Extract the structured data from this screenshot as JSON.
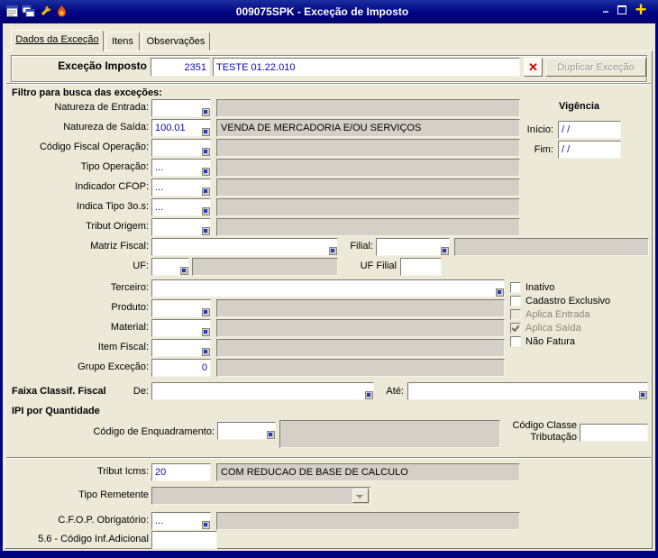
{
  "titlebar": {
    "title": "009075SPK - Exceção de Imposto",
    "minimize_glyph": "−",
    "close_glyph": "+"
  },
  "tabs": {
    "dados": "Dados da Exceção",
    "itens": "Itens",
    "observacoes": "Observações"
  },
  "header": {
    "label": "Exceção Imposto",
    "code": "2351",
    "description": "TESTE 01.22.010",
    "delete_glyph": "✕",
    "duplicate_label": "Duplicar Exceção"
  },
  "filter": {
    "title": "Filtro para busca das exceções:",
    "rows": [
      {
        "label": "Natureza de Entrada:",
        "value": "",
        "detail": ""
      },
      {
        "label": "Natureza de Saída:",
        "value": "100.01",
        "detail": "VENDA DE MERCADORIA E/OU SERVIÇOS"
      },
      {
        "label": "Código Fiscal Operação:",
        "value": "",
        "detail": ""
      },
      {
        "label": "Tipo Operação:",
        "value": "...",
        "detail": ""
      },
      {
        "label": "Indicador CFOP:",
        "value": "...",
        "detail": ""
      },
      {
        "label": "Indica Tipo 3o.s:",
        "value": "...",
        "detail": ""
      },
      {
        "label": "Tribut Origem:",
        "value": "",
        "detail": ""
      }
    ],
    "vigencia": {
      "title": "Vigência",
      "inicio_label": "Início:",
      "inicio_value": "/ /",
      "fim_label": "Fim:",
      "fim_value": "/ /"
    },
    "matriz": {
      "label": "Matriz Fiscal:",
      "value": "",
      "filial_label": "Filial:",
      "filial_value": "",
      "filial_detail": ""
    },
    "uf": {
      "label": "UF:",
      "value": "",
      "detail": "",
      "filial_label": "UF Filial",
      "filial_value": ""
    },
    "terceiro": {
      "label": "Terceiro:",
      "value": ""
    },
    "produto": {
      "label": "Produto:",
      "value": "",
      "detail": ""
    },
    "material": {
      "label": "Material:",
      "value": "",
      "detail": ""
    },
    "item_fiscal": {
      "label": "Item Fiscal:",
      "value": "",
      "detail": ""
    },
    "grupo": {
      "label": "Grupo Exceção:",
      "value": "0",
      "detail": ""
    },
    "checkboxes": [
      {
        "label": "Inativo",
        "checked": false,
        "enabled": true
      },
      {
        "label": "Cadastro Exclusivo",
        "checked": false,
        "enabled": true
      },
      {
        "label": "Aplica Entrada",
        "checked": false,
        "enabled": false
      },
      {
        "label": "Aplica Saída",
        "checked": true,
        "enabled": false
      },
      {
        "label": "Não Fatura",
        "checked": false,
        "enabled": true
      }
    ]
  },
  "faixa": {
    "title": "Faixa Classif. Fiscal",
    "de_label": "De:",
    "de_value": "",
    "ate_label": "Até:",
    "ate_value": ""
  },
  "ipi": {
    "title": "IPI por Quantidade",
    "enquadramento_label": "Código de Enquadramento:",
    "enquadramento_value": "",
    "detail": "",
    "classe_label_1": "Código Classe",
    "classe_label_2": "Tributação",
    "classe_value": ""
  },
  "rodape": {
    "tribut_icms": {
      "label": "Tribut Icms:",
      "value": "20",
      "detail": "COM REDUCAO DE BASE DE CALCULO"
    },
    "tipo_remetente": {
      "label": "Tipo Remetente",
      "value": ""
    },
    "cfop": {
      "label": "C.F.O.P. Obrigatório:",
      "value": "...",
      "detail": ""
    },
    "cod_inf_adicional": {
      "label": "5.6 - Código Inf.Adicional",
      "value": ""
    }
  },
  "colors": {
    "titlebar": "#000282",
    "panel": "#ece9d8",
    "disabled_field": "#d4d0c8",
    "input_text": "#0b0bb0",
    "close_accent": "#ffd400",
    "delete_red": "#d40000"
  }
}
